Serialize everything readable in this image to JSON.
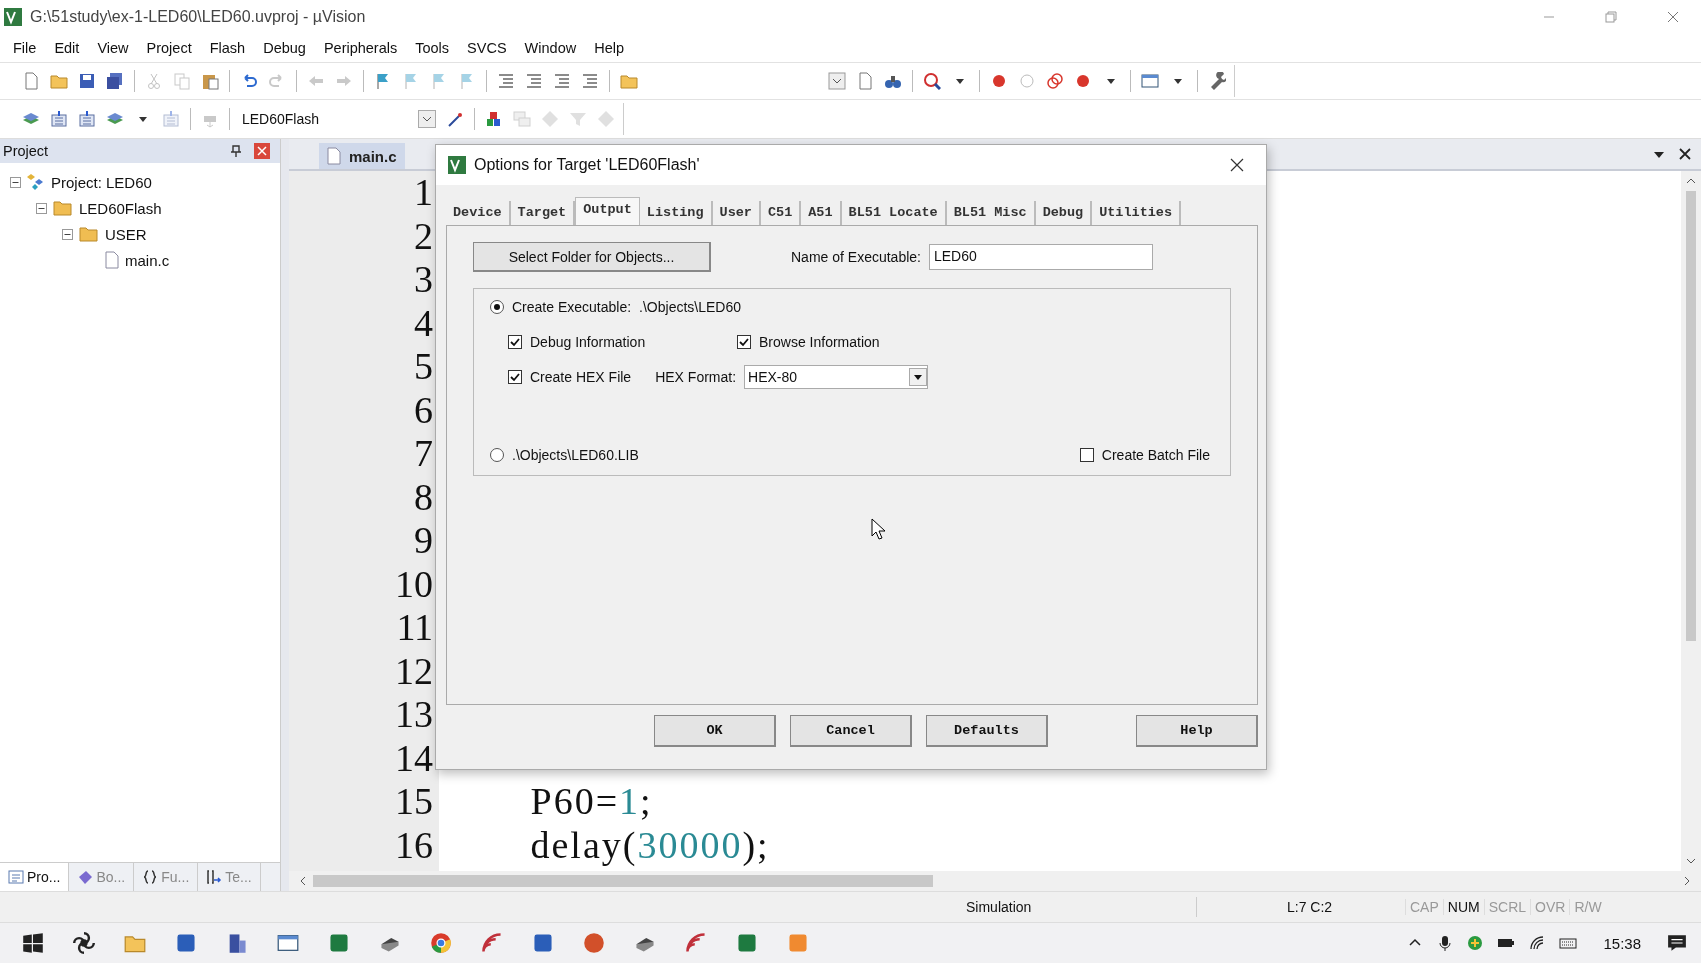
{
  "window": {
    "title": "G:\\51study\\ex-1-LED60\\LED60.uvproj - µVision"
  },
  "menu": [
    "File",
    "Edit",
    "View",
    "Project",
    "Flash",
    "Debug",
    "Peripherals",
    "Tools",
    "SVCS",
    "Window",
    "Help"
  ],
  "build_toolbar": {
    "target": "LED60Flash"
  },
  "project_panel": {
    "title": "Project",
    "tree": [
      {
        "label": "Project: LED60",
        "kind": "project",
        "expanded": true,
        "children": [
          {
            "label": "LED60Flash",
            "kind": "target",
            "expanded": true,
            "children": [
              {
                "label": "USER",
                "kind": "group",
                "expanded": true,
                "children": [
                  {
                    "label": "main.c",
                    "kind": "file"
                  }
                ]
              }
            ]
          }
        ]
      }
    ],
    "tabs": [
      {
        "label": "Pro...",
        "kind": "project",
        "selected": true
      },
      {
        "label": "Bo...",
        "kind": "books",
        "selected": false
      },
      {
        "label": "Fu...",
        "kind": "functions",
        "selected": false
      },
      {
        "label": "Te...",
        "kind": "templates",
        "selected": false
      }
    ]
  },
  "editor": {
    "tabs": [
      {
        "label": "main.c",
        "selected": true
      }
    ],
    "lines": [
      {
        "number": "1"
      },
      {
        "number": "2"
      },
      {
        "number": "3"
      },
      {
        "number": "4"
      },
      {
        "number": "5"
      },
      {
        "number": "6"
      },
      {
        "number": "7"
      },
      {
        "number": "8"
      },
      {
        "number": "9"
      },
      {
        "number": "10"
      },
      {
        "number": "11"
      },
      {
        "number": "12"
      },
      {
        "number": "13"
      },
      {
        "number": "14"
      },
      {
        "number": "15",
        "tokens": [
          {
            "text": " P60=",
            "kind": "plain"
          },
          {
            "text": "1",
            "kind": "number"
          },
          {
            "text": ";",
            "kind": "plain"
          }
        ]
      },
      {
        "number": "16",
        "tokens": [
          {
            "text": " delay(",
            "kind": "plain"
          },
          {
            "text": "30000",
            "kind": "number"
          },
          {
            "text": ");",
            "kind": "plain"
          }
        ]
      }
    ]
  },
  "dialog": {
    "title": "Options for Target 'LED60Flash'",
    "tabs": [
      {
        "label": "Device",
        "selected": false
      },
      {
        "label": "Target",
        "selected": false
      },
      {
        "label": "Output",
        "selected": true
      },
      {
        "label": "Listing",
        "selected": false
      },
      {
        "label": "User",
        "selected": false
      },
      {
        "label": "C51",
        "selected": false
      },
      {
        "label": "A51",
        "selected": false
      },
      {
        "label": "BL51 Locate",
        "selected": false
      },
      {
        "label": "BL51 Misc",
        "selected": false
      },
      {
        "label": "Debug",
        "selected": false
      },
      {
        "label": "Utilities",
        "selected": false
      }
    ],
    "select_folder_button": "Select Folder for Objects...",
    "executable_name": {
      "label": "Name of Executable:",
      "value": "LED60"
    },
    "create_executable": {
      "label": "Create Executable:",
      "path": ".\\Objects\\LED60",
      "selected": true
    },
    "debug_information": {
      "label": "Debug Information",
      "checked": true
    },
    "browse_information": {
      "label": "Browse Information",
      "checked": true
    },
    "create_hex_file": {
      "label": "Create HEX File",
      "checked": true
    },
    "hex_format": {
      "label": "HEX Format:",
      "value": "HEX-80"
    },
    "create_library": {
      "label": ".\\Objects\\LED60.LIB",
      "selected": false
    },
    "create_batch_file": {
      "label": "Create Batch File",
      "checked": false
    },
    "buttons": [
      "OK",
      "Cancel",
      "Defaults",
      "Help"
    ]
  },
  "status_bar": {
    "mode": "Simulation",
    "position": "L:7 C:2",
    "indicators": [
      {
        "label": "CAP",
        "on": false
      },
      {
        "label": "NUM",
        "on": true
      },
      {
        "label": "SCRL",
        "on": false
      },
      {
        "label": "OVR",
        "on": false
      },
      {
        "label": "R/W",
        "on": false
      }
    ]
  },
  "taskbar": {
    "clock": "15:38"
  }
}
